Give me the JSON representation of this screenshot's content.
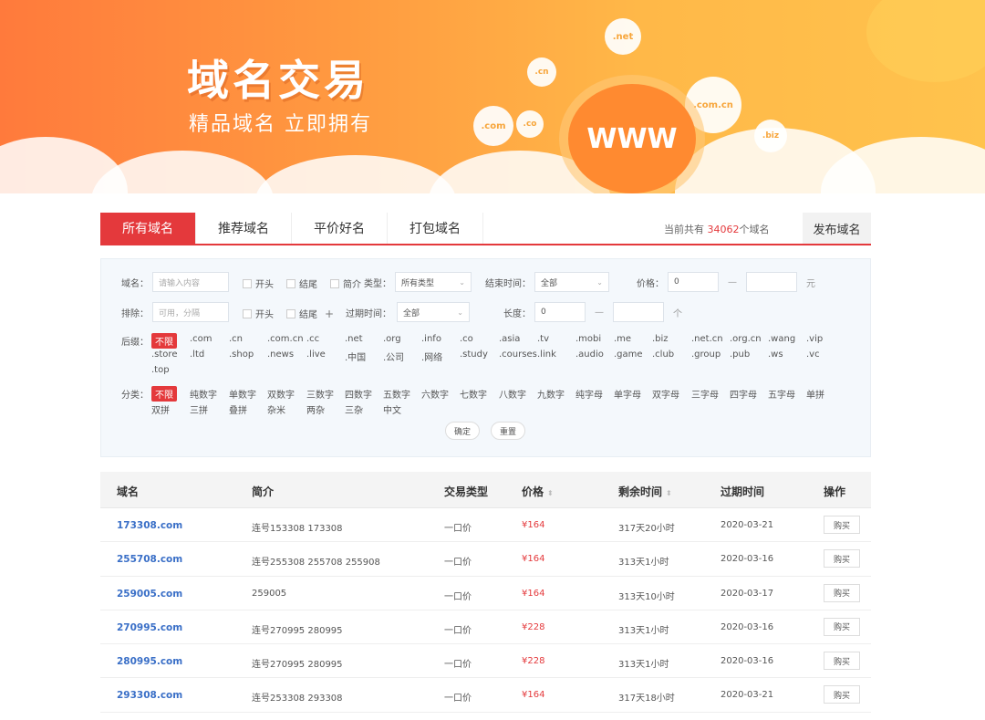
{
  "banner": {
    "title": "域名交易",
    "subtitle": "精品域名 立即拥有",
    "bubbles": [
      ".net",
      ".cn",
      ".com",
      ".co",
      ".com.cn",
      ".biz"
    ],
    "www": "WWW"
  },
  "tabs": {
    "items": [
      "所有域名",
      "推荐域名",
      "平价好名",
      "打包域名"
    ],
    "info_prefix": "当前共有 ",
    "count": "34062",
    "info_suffix": "个域名",
    "publish": "发布域名"
  },
  "filter": {
    "domain_label": "域名：",
    "domain_placeholder": "请输入内容",
    "exclude_label": "排除：",
    "exclude_placeholder": "可用，分隔",
    "start": "开头",
    "end": "结尾",
    "intro": "简介",
    "plus": "+",
    "type_label": "类型：",
    "type_value": "所有类型",
    "endtime_label": "结束时间：",
    "endtime_value": "全部",
    "price_label": "价格：",
    "price_min": "0",
    "price_unit": "元",
    "expire_label": "过期时间：",
    "expire_value": "全部",
    "length_label": "长度：",
    "length_min": "0",
    "length_unit": "个",
    "dash": "—",
    "suffix_label": "后缀：",
    "suffixes_row1": [
      "不限",
      ".com",
      ".cn",
      ".com.cn",
      ".cc",
      ".net",
      ".org",
      ".info",
      ".co",
      ".asia",
      ".tv",
      ".mobi",
      ".me",
      ".biz",
      ".net.cn",
      ".org.cn",
      ".wang",
      ".vip"
    ],
    "suffixes_row2": [
      ".store",
      ".ltd",
      ".shop",
      ".news",
      ".live",
      ".中国",
      ".公司",
      ".网络",
      ".study",
      ".courses",
      ".link",
      ".audio",
      ".game",
      ".club",
      ".group",
      ".pub",
      ".ws",
      ".vc"
    ],
    "suffixes_row3": [
      ".top"
    ],
    "category_label": "分类：",
    "categories_row1": [
      "不限",
      "纯数字",
      "单数字",
      "双数字",
      "三数字",
      "四数字",
      "五数字",
      "六数字",
      "七数字",
      "八数字",
      "九数字",
      "纯字母",
      "单字母",
      "双字母",
      "三字母",
      "四字母",
      "五字母",
      "单拼"
    ],
    "categories_row2": [
      "双拼",
      "三拼",
      "叠拼",
      "杂米",
      "两杂",
      "三杂",
      "中文"
    ],
    "confirm": "确定",
    "reset": "重置"
  },
  "table": {
    "headers": [
      "域名",
      "简介",
      "交易类型",
      "价格",
      "剩余时间",
      "过期时间",
      "操作"
    ],
    "sort_icon": "⬍",
    "rows": [
      {
        "domain": "173308.com",
        "intro": "连号153308 173308",
        "type": "一口价",
        "price": "¥164",
        "remaining": "317天20小时",
        "expire": "2020-03-21",
        "action": "购买"
      },
      {
        "domain": "255708.com",
        "intro": "连号255308 255708 255908",
        "type": "一口价",
        "price": "¥164",
        "remaining": "313天1小时",
        "expire": "2020-03-16",
        "action": "购买"
      },
      {
        "domain": "259005.com",
        "intro": "259005",
        "type": "一口价",
        "price": "¥164",
        "remaining": "313天10小时",
        "expire": "2020-03-17",
        "action": "购买"
      },
      {
        "domain": "270995.com",
        "intro": "连号270995 280995",
        "type": "一口价",
        "price": "¥228",
        "remaining": "313天1小时",
        "expire": "2020-03-16",
        "action": "购买"
      },
      {
        "domain": "280995.com",
        "intro": "连号270995 280995",
        "type": "一口价",
        "price": "¥228",
        "remaining": "313天1小时",
        "expire": "2020-03-16",
        "action": "购买"
      },
      {
        "domain": "293308.com",
        "intro": "连号253308 293308",
        "type": "一口价",
        "price": "¥164",
        "remaining": "317天18小时",
        "expire": "2020-03-21",
        "action": "购买"
      }
    ]
  }
}
